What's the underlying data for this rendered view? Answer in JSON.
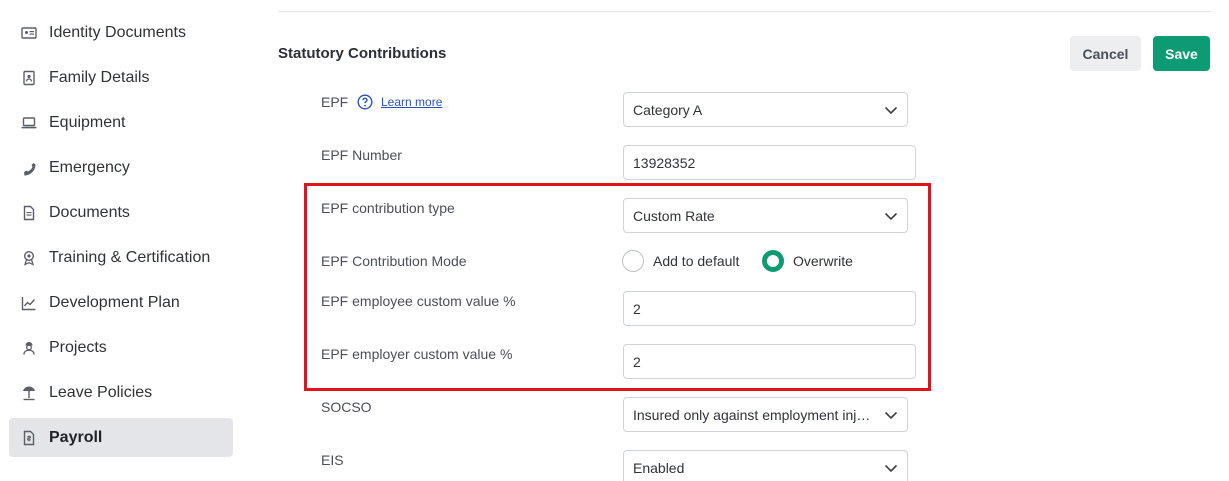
{
  "sidebar": {
    "items": [
      {
        "label": "Identity Documents",
        "icon": "id-card-icon"
      },
      {
        "label": "Family Details",
        "icon": "family-book-icon"
      },
      {
        "label": "Equipment",
        "icon": "laptop-icon"
      },
      {
        "label": "Emergency",
        "icon": "phone-icon"
      },
      {
        "label": "Documents",
        "icon": "document-icon"
      },
      {
        "label": "Training & Certification",
        "icon": "award-icon"
      },
      {
        "label": "Development Plan",
        "icon": "trend-chart-icon"
      },
      {
        "label": "Projects",
        "icon": "user-hat-icon"
      },
      {
        "label": "Leave Policies",
        "icon": "beach-umbrella-icon"
      },
      {
        "label": "Payroll",
        "icon": "payroll-document-icon",
        "active": true
      }
    ]
  },
  "main": {
    "section_title": "Statutory Contributions",
    "cancel_label": "Cancel",
    "save_label": "Save",
    "learn_more": "Learn more",
    "fields": {
      "epf": {
        "label": "EPF",
        "value": "Category A"
      },
      "epf_number": {
        "label": "EPF Number",
        "value": "13928352"
      },
      "epf_contribution_type": {
        "label": "EPF contribution type",
        "value": "Custom Rate"
      },
      "epf_contribution_mode": {
        "label": "EPF Contribution Mode",
        "options": [
          "Add to default",
          "Overwrite"
        ],
        "selected": "Overwrite"
      },
      "epf_employee_custom": {
        "label": "EPF employee custom value %",
        "value": "2"
      },
      "epf_employer_custom": {
        "label": "EPF employer custom value %",
        "value": "2"
      },
      "socso": {
        "label": "SOCSO",
        "value": "Insured only against employment injury"
      },
      "eis": {
        "label": "EIS",
        "value": "Enabled"
      }
    }
  },
  "colors": {
    "accent": "#0d9b73",
    "highlight": "#e0141a",
    "active_nav_bg": "#e3e5e8",
    "link": "#2a52be"
  }
}
